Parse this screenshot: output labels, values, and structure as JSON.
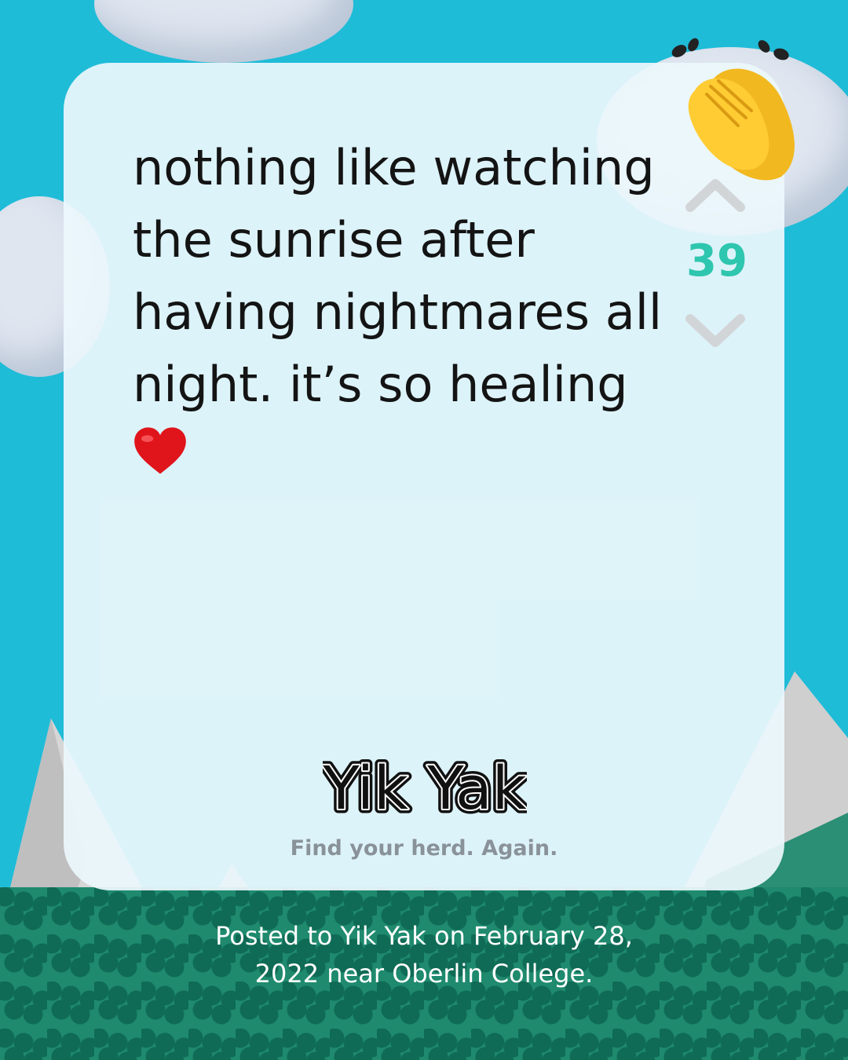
{
  "post": {
    "text": "nothing like watching the sunrise after having nightmares all night. it’s so healing",
    "emoji": "red-heart-icon"
  },
  "vote": {
    "count": "39",
    "up_icon": "chevron-up-icon",
    "down_icon": "chevron-down-icon",
    "count_color": "#2ec6ae"
  },
  "sticker": "clapping-hands-icon",
  "brand": {
    "logo_text": "Yik Yak",
    "tagline": "Find your herd. Again."
  },
  "caption": "Posted to Yik Yak on February 28, 2022 near Oberlin College.",
  "colors": {
    "sky": "#1fbcd8",
    "card": "#ecf8fc",
    "text": "#141414",
    "tagline": "#8a9299"
  }
}
